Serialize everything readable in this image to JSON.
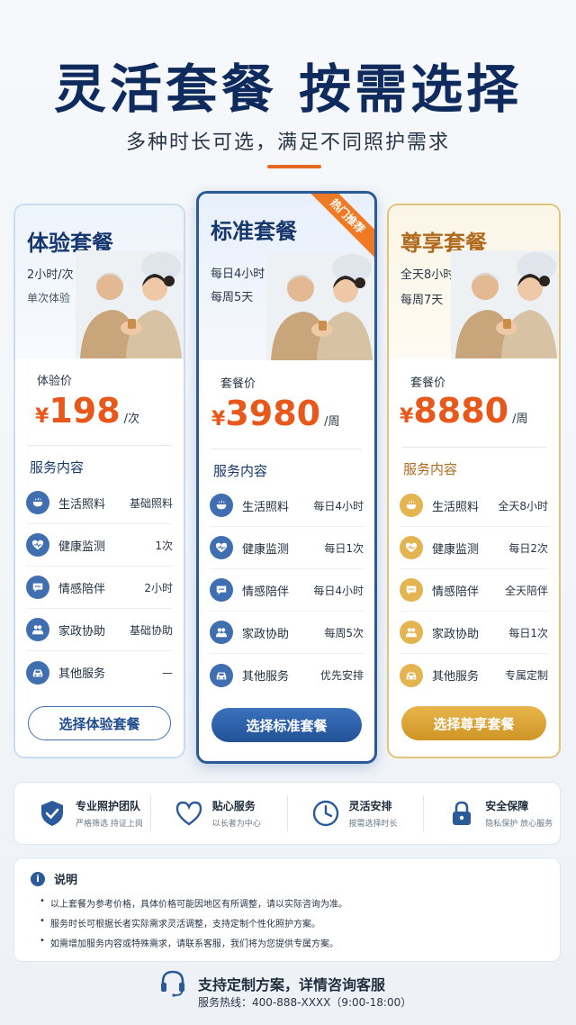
{
  "header": {
    "title": "灵活套餐 按需选择",
    "subtitle": "多种时长可选，满足不同照护需求"
  },
  "colors": {
    "navy": "#16386e",
    "accent_orange": "#e8581a",
    "blue": "#3f6fb0",
    "gold": "#e3b450"
  },
  "plans": [
    {
      "name": "体验套餐",
      "sub1": "2小时/次",
      "sub2": "单次体验",
      "price_label": "体验价",
      "currency": "¥",
      "price": "198",
      "unit": "/次",
      "section_title": "服务内容",
      "services": [
        {
          "icon": "bowl-icon",
          "name": "生活照料",
          "value": "基础照料"
        },
        {
          "icon": "heart-pulse-icon",
          "name": "健康监测",
          "value": "1次"
        },
        {
          "icon": "chat-icon",
          "name": "情感陪伴",
          "value": "2小时"
        },
        {
          "icon": "people-icon",
          "name": "家政协助",
          "value": "基础协助"
        },
        {
          "icon": "car-icon",
          "name": "其他服务",
          "value": "—"
        }
      ],
      "cta": "选择体验套餐"
    },
    {
      "name": "标准套餐",
      "badge": "热门推荐",
      "sub1": "每日4小时",
      "sub2": "每周5天",
      "price_label": "套餐价",
      "currency": "¥",
      "price": "3980",
      "unit": "/周",
      "section_title": "服务内容",
      "services": [
        {
          "icon": "bowl-icon",
          "name": "生活照料",
          "value": "每日4小时"
        },
        {
          "icon": "heart-pulse-icon",
          "name": "健康监测",
          "value": "每日1次"
        },
        {
          "icon": "chat-icon",
          "name": "情感陪伴",
          "value": "每日4小时"
        },
        {
          "icon": "people-icon",
          "name": "家政协助",
          "value": "每周5次"
        },
        {
          "icon": "car-icon",
          "name": "其他服务",
          "value": "优先安排"
        }
      ],
      "cta": "选择标准套餐"
    },
    {
      "name": "尊享套餐",
      "sub1": "全天8小时",
      "sub2": "每周7天",
      "price_label": "套餐价",
      "currency": "¥",
      "price": "8880",
      "unit": "/周",
      "section_title": "服务内容",
      "services": [
        {
          "icon": "bowl-icon",
          "name": "生活照料",
          "value": "全天8小时"
        },
        {
          "icon": "heart-pulse-icon",
          "name": "健康监测",
          "value": "每日2次"
        },
        {
          "icon": "chat-icon",
          "name": "情感陪伴",
          "value": "全天陪伴"
        },
        {
          "icon": "people-icon",
          "name": "家政协助",
          "value": "每日1次"
        },
        {
          "icon": "car-icon",
          "name": "其他服务",
          "value": "专属定制"
        }
      ],
      "cta": "选择尊享套餐"
    }
  ],
  "features": [
    {
      "icon": "shield-check-icon",
      "title": "专业照护团队",
      "desc": "严格筛选 持证上岗"
    },
    {
      "icon": "heart-icon",
      "title": "贴心服务",
      "desc": "以长者为中心"
    },
    {
      "icon": "clock-icon",
      "title": "灵活安排",
      "desc": "按需选择时长"
    },
    {
      "icon": "lock-icon",
      "title": "安全保障",
      "desc": "隐私保护 放心服务"
    }
  ],
  "notes": {
    "title": "说明",
    "items": [
      "以上套餐为参考价格，具体价格可能因地区有所调整，请以实际咨询为准。",
      "服务时长可根据长者实际需求灵活调整，支持定制个性化照护方案。",
      "如需增加服务内容或特殊需求，请联系客服，我们将为您提供专属方案。"
    ]
  },
  "footer": {
    "title": "支持定制方案，详情咨询客服",
    "hotline": "服务热线：400-888-XXXX（9:00-18:00）"
  }
}
